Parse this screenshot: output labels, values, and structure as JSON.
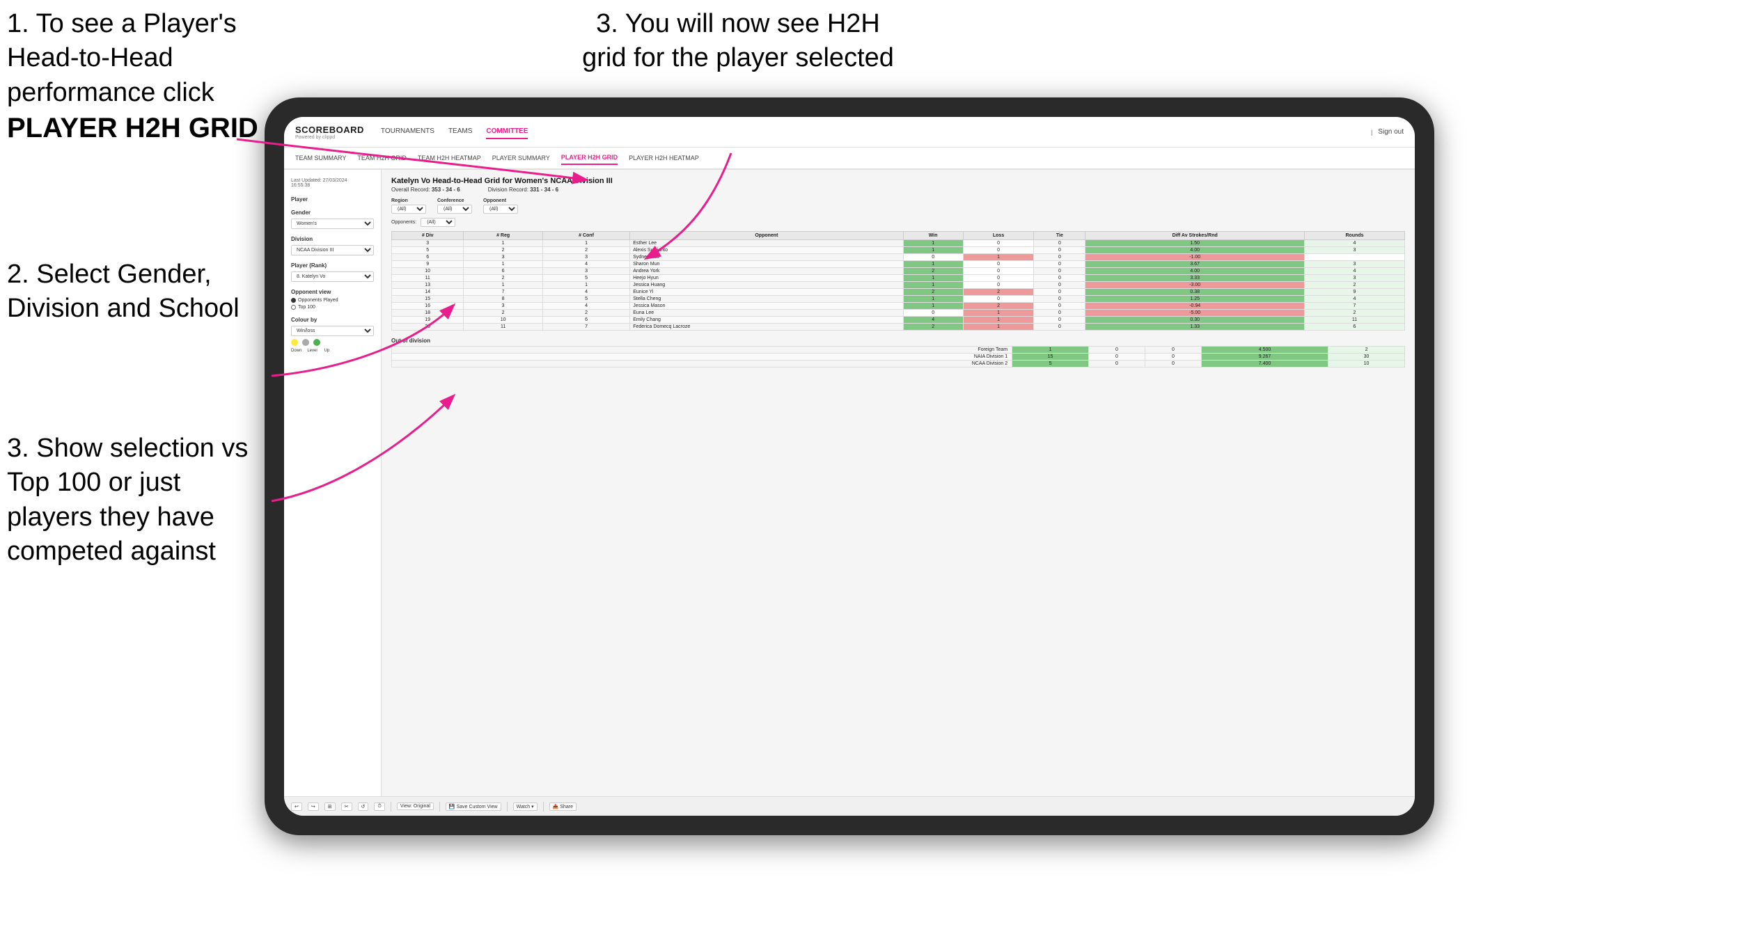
{
  "instructions": {
    "step1_title": "1. To see a Player's Head-to-Head performance click",
    "step1_bold": "PLAYER H2H GRID",
    "step2": "2. Select Gender, Division and School",
    "step3_left": "3. Show selection vs Top 100 or just players they have competed against",
    "step3_right": "3. You will now see H2H grid for the player selected"
  },
  "nav": {
    "logo": "SCOREBOARD",
    "logo_sub": "Powered by clippd",
    "items": [
      "TOURNAMENTS",
      "TEAMS",
      "COMMITTEE"
    ],
    "active_item": "COMMITTEE",
    "sign_out": "Sign out"
  },
  "sub_nav": {
    "items": [
      "TEAM SUMMARY",
      "TEAM H2H GRID",
      "TEAM H2H HEATMAP",
      "PLAYER SUMMARY",
      "PLAYER H2H GRID",
      "PLAYER H2H HEATMAP"
    ],
    "active": "PLAYER H2H GRID"
  },
  "sidebar": {
    "last_updated_label": "Last Updated: 27/03/2024",
    "last_updated_time": "16:55:38",
    "player_label": "Player",
    "gender_label": "Gender",
    "gender_value": "Women's",
    "division_label": "Division",
    "division_value": "NCAA Division III",
    "player_rank_label": "Player (Rank)",
    "player_rank_value": "8. Katelyn Vo",
    "opponent_view_label": "Opponent view",
    "radio_options": [
      "Opponents Played",
      "Top 100"
    ],
    "radio_selected": "Opponents Played",
    "colour_label": "Colour by",
    "colour_value": "Win/loss",
    "colour_dots": [
      {
        "color": "#ffeb3b",
        "label": "Down"
      },
      {
        "color": "#aaaaaa",
        "label": "Level"
      },
      {
        "color": "#4caf50",
        "label": "Up"
      }
    ]
  },
  "grid": {
    "title": "Katelyn Vo Head-to-Head Grid for Women's NCAA Division III",
    "overall_record_label": "Overall Record:",
    "overall_record": "353 - 34 - 6",
    "division_record_label": "Division Record:",
    "division_record": "331 - 34 - 6",
    "filter_region_label": "Region",
    "filter_conference_label": "Conference",
    "filter_opponent_label": "Opponent",
    "opponents_label": "Opponents:",
    "filter_all": "(All)",
    "col_headers": [
      "# Div",
      "# Reg",
      "# Conf",
      "Opponent",
      "Win",
      "Loss",
      "Tie",
      "Diff Av Strokes/Rnd",
      "Rounds"
    ],
    "rows": [
      {
        "div": "3",
        "reg": "1",
        "conf": "1",
        "opponent": "Esther Lee",
        "win": 1,
        "loss": 0,
        "tie": 0,
        "diff": "1.50",
        "rounds": 4,
        "win_color": "green"
      },
      {
        "div": "5",
        "reg": "2",
        "conf": "2",
        "opponent": "Alexis Sudjianto",
        "win": 1,
        "loss": 0,
        "tie": 0,
        "diff": "4.00",
        "rounds": 3,
        "win_color": "green"
      },
      {
        "div": "6",
        "reg": "3",
        "conf": "3",
        "opponent": "Sydney Kuo",
        "win": 0,
        "loss": 1,
        "tie": 0,
        "diff": "-1.00",
        "rounds": "",
        "win_color": "loss"
      },
      {
        "div": "9",
        "reg": "1",
        "conf": "4",
        "opponent": "Sharon Mun",
        "win": 1,
        "loss": 0,
        "tie": 0,
        "diff": "3.67",
        "rounds": 3,
        "win_color": "green"
      },
      {
        "div": "10",
        "reg": "6",
        "conf": "3",
        "opponent": "Andrea York",
        "win": 2,
        "loss": 0,
        "tie": 0,
        "diff": "4.00",
        "rounds": 4,
        "win_color": "green"
      },
      {
        "div": "11",
        "reg": "2",
        "conf": "5",
        "opponent": "Heejo Hyun",
        "win": 1,
        "loss": 0,
        "tie": 0,
        "diff": "3.33",
        "rounds": 3,
        "win_color": "green"
      },
      {
        "div": "13",
        "reg": "1",
        "conf": "1",
        "opponent": "Jessica Huang",
        "win": 1,
        "loss": 0,
        "tie": 0,
        "diff": "-3.00",
        "rounds": 2,
        "win_color": "yellow"
      },
      {
        "div": "14",
        "reg": "7",
        "conf": "4",
        "opponent": "Eunice Yi",
        "win": 2,
        "loss": 2,
        "tie": 0,
        "diff": "0.38",
        "rounds": 9,
        "win_color": "yellow"
      },
      {
        "div": "15",
        "reg": "8",
        "conf": "5",
        "opponent": "Stella Cheng",
        "win": 1,
        "loss": 0,
        "tie": 0,
        "diff": "1.25",
        "rounds": 4,
        "win_color": "green"
      },
      {
        "div": "16",
        "reg": "3",
        "conf": "4",
        "opponent": "Jessica Mason",
        "win": 1,
        "loss": 2,
        "tie": 0,
        "diff": "-0.94",
        "rounds": 7,
        "win_color": "loss"
      },
      {
        "div": "18",
        "reg": "2",
        "conf": "2",
        "opponent": "Euna Lee",
        "win": 0,
        "loss": 1,
        "tie": 0,
        "diff": "-5.00",
        "rounds": 2,
        "win_color": "loss"
      },
      {
        "div": "19",
        "reg": "10",
        "conf": "6",
        "opponent": "Emily Chang",
        "win": 4,
        "loss": 1,
        "tie": 0,
        "diff": "0.30",
        "rounds": 11,
        "win_color": "green"
      },
      {
        "div": "20",
        "reg": "11",
        "conf": "7",
        "opponent": "Federica Domecq Lacroze",
        "win": 2,
        "loss": 1,
        "tie": 0,
        "diff": "1.33",
        "rounds": 6,
        "win_color": "yellow"
      }
    ],
    "out_of_division_label": "Out of division",
    "out_of_division_rows": [
      {
        "label": "Foreign Team",
        "win": 1,
        "loss": 0,
        "tie": 0,
        "diff": "4.500",
        "rounds": 2
      },
      {
        "label": "NAIA Division 1",
        "win": 15,
        "loss": 0,
        "tie": 0,
        "diff": "9.267",
        "rounds": 30
      },
      {
        "label": "NCAA Division 2",
        "win": 5,
        "loss": 0,
        "tie": 0,
        "diff": "7.400",
        "rounds": 10
      }
    ]
  },
  "toolbar": {
    "undo": "↩",
    "redo": "↪",
    "view_original": "View: Original",
    "save_custom": "Save Custom View",
    "watch": "Watch ▾",
    "share": "Share"
  }
}
